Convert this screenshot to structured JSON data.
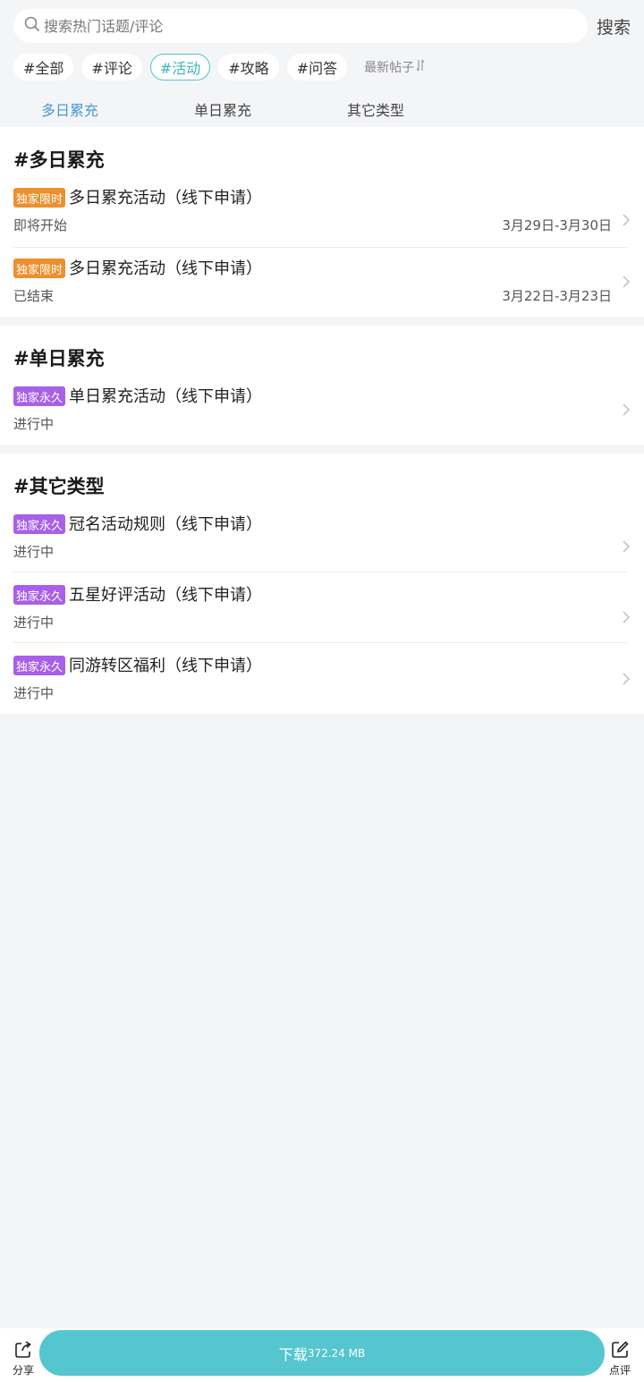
{
  "search": {
    "placeholder": "搜索热门话题/评论",
    "button_label": "搜索"
  },
  "tags": [
    {
      "label": "#全部",
      "active": false
    },
    {
      "label": "#评论",
      "active": false
    },
    {
      "label": "#活动",
      "active": true
    },
    {
      "label": "#攻略",
      "active": false
    },
    {
      "label": "#问答",
      "active": false
    }
  ],
  "sort_label": "最新帖子",
  "subtabs": [
    {
      "label": "多日累充",
      "active": true
    },
    {
      "label": "单日累充",
      "active": false
    },
    {
      "label": "其它类型",
      "active": false
    }
  ],
  "sections": [
    {
      "title": "#多日累充",
      "items": [
        {
          "badge": "独家限时",
          "badge_color": "#ee8f2d",
          "title": "多日累充活动（线下申请）",
          "status": "即将开始",
          "date": "3月29日-3月30日"
        },
        {
          "badge": "独家限时",
          "badge_color": "#ee8f2d",
          "title": "多日累充活动（线下申请）",
          "status": "已结束",
          "date": "3月22日-3月23日"
        }
      ]
    },
    {
      "title": "#单日累充",
      "items": [
        {
          "badge": "独家永久",
          "badge_color": "#a860e8",
          "title": "单日累充活动（线下申请）",
          "status": "进行中",
          "date": ""
        }
      ]
    },
    {
      "title": "#其它类型",
      "items": [
        {
          "badge": "独家永久",
          "badge_color": "#a860e8",
          "title": "冠名活动规则（线下申请）",
          "status": "进行中",
          "date": ""
        },
        {
          "badge": "独家永久",
          "badge_color": "#a860e8",
          "title": "五星好评活动（线下申请）",
          "status": "进行中",
          "date": ""
        },
        {
          "badge": "独家永久",
          "badge_color": "#a860e8",
          "title": "同游转区福利（线下申请）",
          "status": "进行中",
          "date": ""
        }
      ]
    }
  ],
  "bottom": {
    "share_label": "分享",
    "download_label": "下载",
    "download_size": "372.24 MB",
    "review_label": "点评",
    "accent_color": "#55c6cf"
  }
}
